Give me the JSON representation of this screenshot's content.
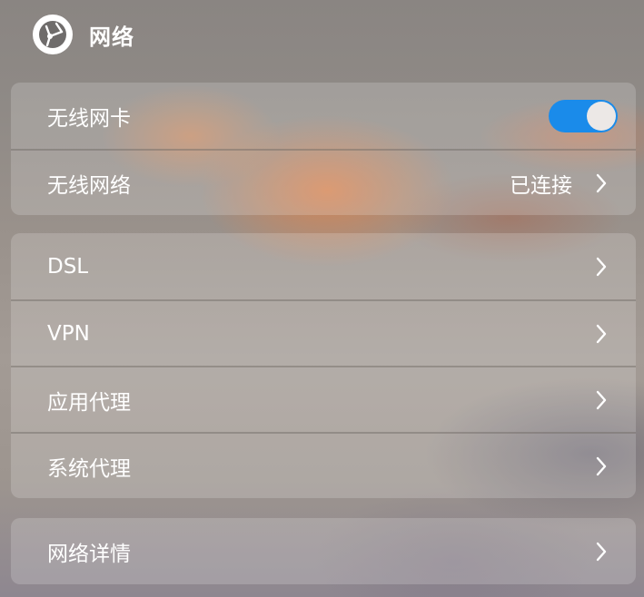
{
  "header": {
    "title": "网络",
    "icon": "network-globe-icon"
  },
  "wireless_card": {
    "adapter": {
      "label": "无线网卡",
      "toggle_on": true,
      "toggle_color": "#1a8bea"
    },
    "wifi": {
      "label": "无线网络",
      "status": "已连接"
    }
  },
  "connections_card": {
    "items": [
      {
        "label": "DSL"
      },
      {
        "label": "VPN"
      },
      {
        "label": "应用代理"
      },
      {
        "label": "系统代理"
      }
    ]
  },
  "details_card": {
    "label": "网络详情"
  },
  "icons": {
    "chevron": "chevron-right-icon"
  }
}
